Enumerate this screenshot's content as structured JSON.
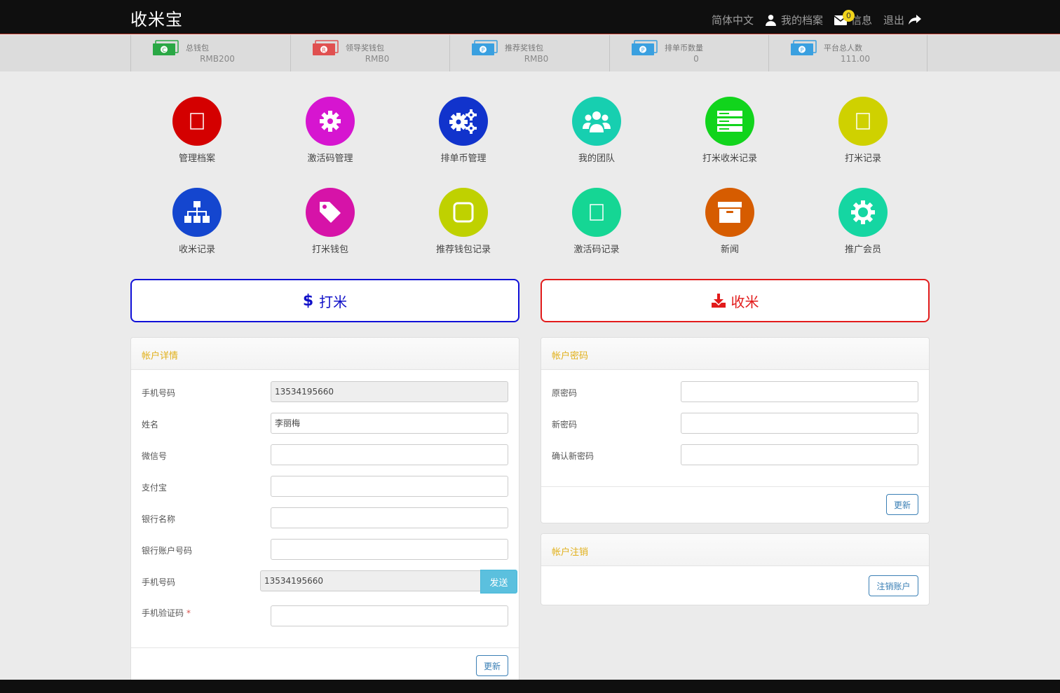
{
  "brand": "收米宝",
  "nav": {
    "language": "简体中文",
    "profile": "我的档案",
    "messages": "信息",
    "message_count": "0",
    "logout": "退出"
  },
  "stats": [
    {
      "label": "总钱包",
      "value": "RMB200",
      "color": "#2aa845",
      "mark": "C"
    },
    {
      "label": "领导奖钱包",
      "value": "RMB0",
      "color": "#e05050",
      "mark": "R"
    },
    {
      "label": "推荐奖钱包",
      "value": "RMB0",
      "color": "#3aa0e0",
      "mark": "P"
    },
    {
      "label": "排单币数量",
      "value": "0",
      "color": "#3aa0e0",
      "mark": "P"
    },
    {
      "label": "平台总人数",
      "value": "111.00",
      "color": "#3aa0e0",
      "mark": "P"
    }
  ],
  "tiles": [
    {
      "label": "管理档案",
      "color": "#d40000",
      "icon": "placeholder-icon"
    },
    {
      "label": "激活码管理",
      "color": "#d615d0",
      "icon": "gear-icon"
    },
    {
      "label": "排单币管理",
      "color": "#1133cc",
      "icon": "gears-icon"
    },
    {
      "label": "我的团队",
      "color": "#17cfb0",
      "icon": "users-icon"
    },
    {
      "label": "打米收米记录",
      "color": "#11d41c",
      "icon": "server-icon"
    },
    {
      "label": "打米记录",
      "color": "#cfd100",
      "icon": "placeholder-icon"
    },
    {
      "label": "收米记录",
      "color": "#1446cf",
      "icon": "sitemap-icon"
    },
    {
      "label": "打米钱包",
      "color": "#d613a8",
      "icon": "tag-icon"
    },
    {
      "label": "推荐钱包记录",
      "color": "#bfd100",
      "icon": "square-icon"
    },
    {
      "label": "激活码记录",
      "color": "#15d694",
      "icon": "placeholder-icon"
    },
    {
      "label": "新闻",
      "color": "#d65c00",
      "icon": "archive-icon"
    },
    {
      "label": "推广会员",
      "color": "#15d6a2",
      "icon": "cog-icon"
    }
  ],
  "actions": {
    "send": "打米",
    "receive": "收米"
  },
  "account": {
    "title": "帐户详情",
    "fields": [
      {
        "label": "手机号码",
        "value": "13534195660",
        "readonly": true
      },
      {
        "label": "姓名",
        "value": "李丽梅",
        "readonly": false
      },
      {
        "label": "微信号",
        "value": "",
        "readonly": false
      },
      {
        "label": "支付宝",
        "value": "",
        "readonly": false
      },
      {
        "label": "银行名称",
        "value": "",
        "readonly": false
      },
      {
        "label": "银行账户号码",
        "value": "",
        "readonly": false
      }
    ],
    "verify_phone_label": "手机号码",
    "verify_phone_value": "13534195660",
    "send_code": "发送",
    "code_label": "手机验证码",
    "code_required": "*",
    "update": "更新"
  },
  "password": {
    "title": "帐户密码",
    "fields": [
      {
        "label": "原密码"
      },
      {
        "label": "新密码"
      },
      {
        "label": "确认新密码"
      }
    ],
    "update": "更新"
  },
  "cancel": {
    "title": "帐户注销",
    "button": "注销账户"
  }
}
